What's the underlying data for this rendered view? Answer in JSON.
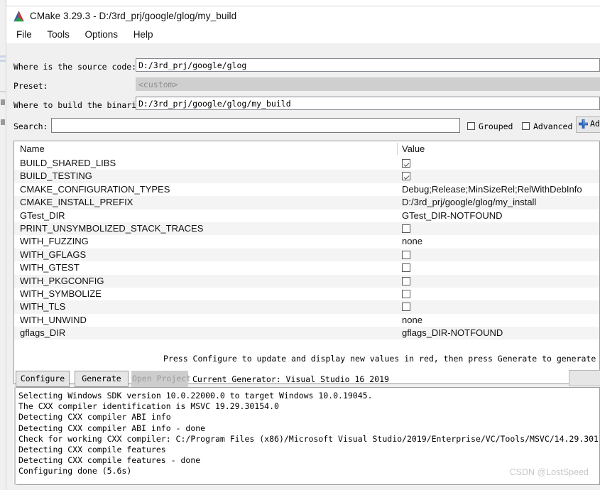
{
  "window": {
    "title": "CMake 3.29.3 - D:/3rd_prj/google/glog/my_build",
    "icon": "cmake-logo-icon"
  },
  "menu": {
    "items": [
      {
        "label": "File"
      },
      {
        "label": "Tools"
      },
      {
        "label": "Options"
      },
      {
        "label": "Help"
      }
    ]
  },
  "form": {
    "source_label": "Where is the source code:",
    "source_value": "D:/3rd_prj/google/glog",
    "preset_label": "Preset:",
    "preset_value": "<custom>",
    "build_label": "Where to build the binaries:",
    "build_value": "D:/3rd_prj/google/glog/my_build",
    "search_label": "Search:",
    "search_value": "",
    "grouped_label": "Grouped",
    "grouped_checked": false,
    "advanced_label": "Advanced",
    "advanced_checked": false,
    "add_entry_label": "Add",
    "add_entry_icon": "plus-icon"
  },
  "table": {
    "columns": [
      "Name",
      "Value"
    ],
    "rows": [
      {
        "name": "BUILD_SHARED_LIBS",
        "type": "checkbox",
        "value": "",
        "checked": true
      },
      {
        "name": "BUILD_TESTING",
        "type": "checkbox",
        "value": "",
        "checked": true
      },
      {
        "name": "CMAKE_CONFIGURATION_TYPES",
        "type": "text",
        "value": "Debug;Release;MinSizeRel;RelWithDebInfo"
      },
      {
        "name": "CMAKE_INSTALL_PREFIX",
        "type": "text",
        "value": "D:/3rd_prj/google/glog/my_install"
      },
      {
        "name": "GTest_DIR",
        "type": "text",
        "value": "GTest_DIR-NOTFOUND"
      },
      {
        "name": "PRINT_UNSYMBOLIZED_STACK_TRACES",
        "type": "checkbox",
        "value": "",
        "checked": false
      },
      {
        "name": "WITH_FUZZING",
        "type": "text",
        "value": "none"
      },
      {
        "name": "WITH_GFLAGS",
        "type": "checkbox",
        "value": "",
        "checked": false
      },
      {
        "name": "WITH_GTEST",
        "type": "checkbox",
        "value": "",
        "checked": false
      },
      {
        "name": "WITH_PKGCONFIG",
        "type": "checkbox",
        "value": "",
        "checked": false
      },
      {
        "name": "WITH_SYMBOLIZE",
        "type": "checkbox",
        "value": "",
        "checked": false
      },
      {
        "name": "WITH_TLS",
        "type": "checkbox",
        "value": "",
        "checked": false
      },
      {
        "name": "WITH_UNWIND",
        "type": "text",
        "value": "none"
      },
      {
        "name": "gflags_DIR",
        "type": "text",
        "value": "gflags_DIR-NOTFOUND"
      }
    ]
  },
  "actions": {
    "hint": "Press Configure to update and display new values in red, then press Generate to generate selected build",
    "configure_label": "Configure",
    "generate_label": "Generate",
    "open_project_label": "Open Project",
    "generator_label": "Current Generator: Visual Studio 16 2019",
    "extra_button_label": ""
  },
  "log": {
    "lines": [
      "Selecting Windows SDK version 10.0.22000.0 to target Windows 10.0.19045.",
      "The CXX compiler identification is MSVC 19.29.30154.0",
      "Detecting CXX compiler ABI info",
      "Detecting CXX compiler ABI info - done",
      "Check for working CXX compiler: C:/Program Files (x86)/Microsoft Visual Studio/2019/Enterprise/VC/Tools/MSVC/14.29.301",
      "Detecting CXX compile features",
      "Detecting CXX compile features - done",
      "Configuring done (5.6s)"
    ]
  },
  "watermark": {
    "text": "CSDN @LostSpeed"
  }
}
